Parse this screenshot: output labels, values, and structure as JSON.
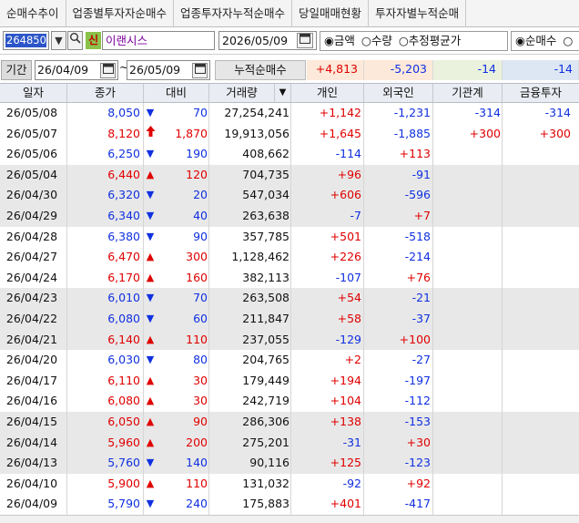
{
  "tabs": [
    "순매수추이",
    "업종별투자자순매수",
    "업종투자자누적순매수",
    "당일매매현황",
    "투자자별누적순매"
  ],
  "toolbar": {
    "code": "264850",
    "dropdown_icon": "▼",
    "search_icon": "🔍",
    "credit_badge": "신",
    "stock_name": "이랜시스",
    "date": "2026/05/09",
    "calendar_icon": "▦",
    "unit_options": [
      "◉금액",
      "○수량",
      "○추정평균가"
    ],
    "type_options": [
      "◉순매수",
      "○"
    ]
  },
  "period": {
    "label": "기간",
    "start": "26/04/09",
    "end": "26/05/09",
    "tilde": "~",
    "mode": "누적순매수",
    "cumulative": {
      "individual": "+4,813",
      "foreign": "-5,203",
      "institution": "-14",
      "financial": "-14"
    }
  },
  "colors": {
    "up": "#e00000",
    "down": "#1030e0",
    "shade": "#e8e8e8"
  },
  "table": {
    "headers": {
      "date": "일자",
      "close": "종가",
      "change": "대비",
      "volume": "거래량",
      "individual": "개인",
      "foreign": "외국인",
      "institution": "기관계",
      "financial": "금융투자"
    },
    "rows": [
      {
        "date": "26/05/08",
        "close": "8,050",
        "dir": "down",
        "arrow": "▼",
        "change": "70",
        "volume": "27,254,241",
        "ind": "+1,142",
        "for": "-1,231",
        "inst": "-314",
        "fin": "-314",
        "shade": false
      },
      {
        "date": "26/05/07",
        "close": "8,120",
        "dir": "up",
        "arrow": "🡅",
        "change": "1,870",
        "volume": "19,913,056",
        "ind": "+1,645",
        "for": "-1,885",
        "inst": "+300",
        "fin": "+300",
        "shade": false
      },
      {
        "date": "26/05/06",
        "close": "6,250",
        "dir": "down",
        "arrow": "▼",
        "change": "190",
        "volume": "408,662",
        "ind": "-114",
        "for": "+113",
        "inst": "",
        "fin": "",
        "shade": false
      },
      {
        "date": "26/05/04",
        "close": "6,440",
        "dir": "up",
        "arrow": "▲",
        "change": "120",
        "volume": "704,735",
        "ind": "+96",
        "for": "-91",
        "inst": "",
        "fin": "",
        "shade": true
      },
      {
        "date": "26/04/30",
        "close": "6,320",
        "dir": "down",
        "arrow": "▼",
        "change": "20",
        "volume": "547,034",
        "ind": "+606",
        "for": "-596",
        "inst": "",
        "fin": "",
        "shade": true
      },
      {
        "date": "26/04/29",
        "close": "6,340",
        "dir": "down",
        "arrow": "▼",
        "change": "40",
        "volume": "263,638",
        "ind": "-7",
        "for": "+7",
        "inst": "",
        "fin": "",
        "shade": true
      },
      {
        "date": "26/04/28",
        "close": "6,380",
        "dir": "down",
        "arrow": "▼",
        "change": "90",
        "volume": "357,785",
        "ind": "+501",
        "for": "-518",
        "inst": "",
        "fin": "",
        "shade": false
      },
      {
        "date": "26/04/27",
        "close": "6,470",
        "dir": "up",
        "arrow": "▲",
        "change": "300",
        "volume": "1,128,462",
        "ind": "+226",
        "for": "-214",
        "inst": "",
        "fin": "",
        "shade": false
      },
      {
        "date": "26/04/24",
        "close": "6,170",
        "dir": "up",
        "arrow": "▲",
        "change": "160",
        "volume": "382,113",
        "ind": "-107",
        "for": "+76",
        "inst": "",
        "fin": "",
        "shade": false
      },
      {
        "date": "26/04/23",
        "close": "6,010",
        "dir": "down",
        "arrow": "▼",
        "change": "70",
        "volume": "263,508",
        "ind": "+54",
        "for": "-21",
        "inst": "",
        "fin": "",
        "shade": true
      },
      {
        "date": "26/04/22",
        "close": "6,080",
        "dir": "down",
        "arrow": "▼",
        "change": "60",
        "volume": "211,847",
        "ind": "+58",
        "for": "-37",
        "inst": "",
        "fin": "",
        "shade": true
      },
      {
        "date": "26/04/21",
        "close": "6,140",
        "dir": "up",
        "arrow": "▲",
        "change": "110",
        "volume": "237,055",
        "ind": "-129",
        "for": "+100",
        "inst": "",
        "fin": "",
        "shade": true
      },
      {
        "date": "26/04/20",
        "close": "6,030",
        "dir": "down",
        "arrow": "▼",
        "change": "80",
        "volume": "204,765",
        "ind": "+2",
        "for": "-27",
        "inst": "",
        "fin": "",
        "shade": false
      },
      {
        "date": "26/04/17",
        "close": "6,110",
        "dir": "up",
        "arrow": "▲",
        "change": "30",
        "volume": "179,449",
        "ind": "+194",
        "for": "-197",
        "inst": "",
        "fin": "",
        "shade": false
      },
      {
        "date": "26/04/16",
        "close": "6,080",
        "dir": "up",
        "arrow": "▲",
        "change": "30",
        "volume": "242,719",
        "ind": "+104",
        "for": "-112",
        "inst": "",
        "fin": "",
        "shade": false
      },
      {
        "date": "26/04/15",
        "close": "6,050",
        "dir": "up",
        "arrow": "▲",
        "change": "90",
        "volume": "286,306",
        "ind": "+138",
        "for": "-153",
        "inst": "",
        "fin": "",
        "shade": true
      },
      {
        "date": "26/04/14",
        "close": "5,960",
        "dir": "up",
        "arrow": "▲",
        "change": "200",
        "volume": "275,201",
        "ind": "-31",
        "for": "+30",
        "inst": "",
        "fin": "",
        "shade": true
      },
      {
        "date": "26/04/13",
        "close": "5,760",
        "dir": "down",
        "arrow": "▼",
        "change": "140",
        "volume": "90,116",
        "ind": "+125",
        "for": "-123",
        "inst": "",
        "fin": "",
        "shade": true
      },
      {
        "date": "26/04/10",
        "close": "5,900",
        "dir": "up",
        "arrow": "▲",
        "change": "110",
        "volume": "131,032",
        "ind": "-92",
        "for": "+92",
        "inst": "",
        "fin": "",
        "shade": false
      },
      {
        "date": "26/04/09",
        "close": "5,790",
        "dir": "down",
        "arrow": "▼",
        "change": "240",
        "volume": "175,883",
        "ind": "+401",
        "for": "-417",
        "inst": "",
        "fin": "",
        "shade": false
      }
    ]
  }
}
